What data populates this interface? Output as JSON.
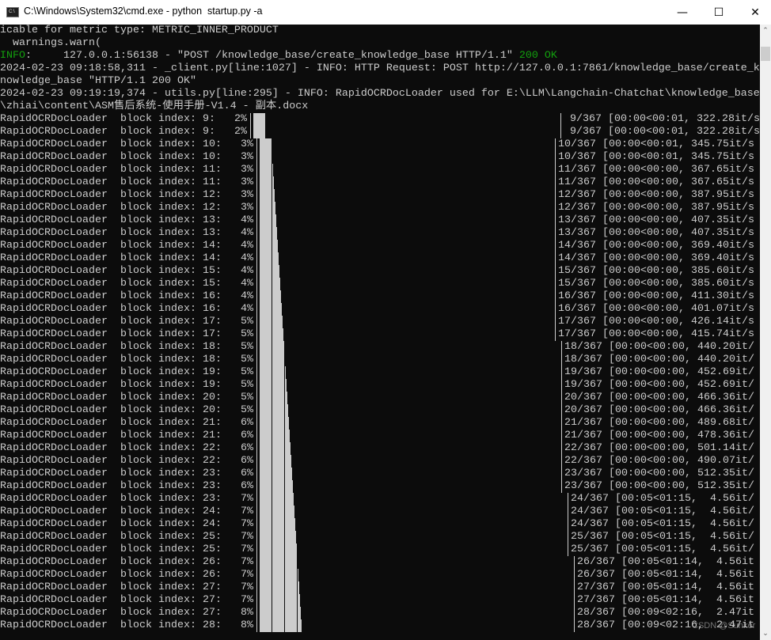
{
  "window": {
    "title": "C:\\Windows\\System32\\cmd.exe - python  startup.py -a",
    "icon": "cmd-icon",
    "icon_label": "C:\\",
    "controls": {
      "minimize": "—",
      "maximize": "☐",
      "close": "✕"
    }
  },
  "colors": {
    "background": "#0c0c0c",
    "text": "#cccccc",
    "green": "#13a10e"
  },
  "log": {
    "line0": "icable for metric type: METRIC_INNER_PRODUCT",
    "line1": "  warnings.warn(",
    "line2_level": "INFO",
    "line2_mid": ":     127.0.0.1:56138 - \"POST /knowledge_base/create_knowledge_base HTTP/1.1\" ",
    "line2_status": "200 OK",
    "line3": "2024-02-23 09:18:58,311 - _client.py[line:1027] - INFO: HTTP Request: POST http://127.0.0.1:7861/knowledge_base/create_k",
    "line4": "nowledge_base \"HTTP/1.1 200 OK\"",
    "line5": "2024-02-23 09:19:19,374 - utils.py[line:295] - INFO: RapidOCRDocLoader used for E:\\LLM\\Langchain-Chatchat\\knowledge_base",
    "line6": "\\zhiai\\content\\ASM售后系统-使用手册-V1.4 - 副本.docx"
  },
  "progress_rows": [
    {
      "desc": "RapidOCRDocLoader  block index: 9:",
      "pct": "2%",
      "count": "9/367",
      "stats": "[00:00<00:01, 322.28it/s"
    },
    {
      "desc": "RapidOCRDocLoader  block index: 9:",
      "pct": "2%",
      "count": "9/367",
      "stats": "[00:00<00:01, 322.28it/s"
    },
    {
      "desc": "RapidOCRDocLoader  block index: 10:",
      "pct": "3%",
      "count": "10/367",
      "stats": "[00:00<00:01, 345.75it/s"
    },
    {
      "desc": "RapidOCRDocLoader  block index: 10:",
      "pct": "3%",
      "count": "10/367",
      "stats": "[00:00<00:01, 345.75it/s"
    },
    {
      "desc": "RapidOCRDocLoader  block index: 11:",
      "pct": "3%",
      "count": "11/367",
      "stats": "[00:00<00:00, 367.65it/s"
    },
    {
      "desc": "RapidOCRDocLoader  block index: 11:",
      "pct": "3%",
      "count": "11/367",
      "stats": "[00:00<00:00, 367.65it/s"
    },
    {
      "desc": "RapidOCRDocLoader  block index: 12:",
      "pct": "3%",
      "count": "12/367",
      "stats": "[00:00<00:00, 387.95it/s"
    },
    {
      "desc": "RapidOCRDocLoader  block index: 12:",
      "pct": "3%",
      "count": "12/367",
      "stats": "[00:00<00:00, 387.95it/s"
    },
    {
      "desc": "RapidOCRDocLoader  block index: 13:",
      "pct": "4%",
      "count": "13/367",
      "stats": "[00:00<00:00, 407.35it/s"
    },
    {
      "desc": "RapidOCRDocLoader  block index: 13:",
      "pct": "4%",
      "count": "13/367",
      "stats": "[00:00<00:00, 407.35it/s"
    },
    {
      "desc": "RapidOCRDocLoader  block index: 14:",
      "pct": "4%",
      "count": "14/367",
      "stats": "[00:00<00:00, 369.40it/s"
    },
    {
      "desc": "RapidOCRDocLoader  block index: 14:",
      "pct": "4%",
      "count": "14/367",
      "stats": "[00:00<00:00, 369.40it/s"
    },
    {
      "desc": "RapidOCRDocLoader  block index: 15:",
      "pct": "4%",
      "count": "15/367",
      "stats": "[00:00<00:00, 385.60it/s"
    },
    {
      "desc": "RapidOCRDocLoader  block index: 15:",
      "pct": "4%",
      "count": "15/367",
      "stats": "[00:00<00:00, 385.60it/s"
    },
    {
      "desc": "RapidOCRDocLoader  block index: 16:",
      "pct": "4%",
      "count": "16/367",
      "stats": "[00:00<00:00, 411.30it/s"
    },
    {
      "desc": "RapidOCRDocLoader  block index: 16:",
      "pct": "4%",
      "count": "16/367",
      "stats": "[00:00<00:00, 401.07it/s"
    },
    {
      "desc": "RapidOCRDocLoader  block index: 17:",
      "pct": "5%",
      "count": "17/367",
      "stats": "[00:00<00:00, 426.14it/s"
    },
    {
      "desc": "RapidOCRDocLoader  block index: 17:",
      "pct": "5%",
      "count": "17/367",
      "stats": "[00:00<00:00, 415.74it/s"
    },
    {
      "desc": "RapidOCRDocLoader  block index: 18:",
      "pct": "5%",
      "count": "18/367",
      "stats": "[00:00<00:00, 440.20it/"
    },
    {
      "desc": "RapidOCRDocLoader  block index: 18:",
      "pct": "5%",
      "count": "18/367",
      "stats": "[00:00<00:00, 440.20it/"
    },
    {
      "desc": "RapidOCRDocLoader  block index: 19:",
      "pct": "5%",
      "count": "19/367",
      "stats": "[00:00<00:00, 452.69it/"
    },
    {
      "desc": "RapidOCRDocLoader  block index: 19:",
      "pct": "5%",
      "count": "19/367",
      "stats": "[00:00<00:00, 452.69it/"
    },
    {
      "desc": "RapidOCRDocLoader  block index: 20:",
      "pct": "5%",
      "count": "20/367",
      "stats": "[00:00<00:00, 466.36it/"
    },
    {
      "desc": "RapidOCRDocLoader  block index: 20:",
      "pct": "5%",
      "count": "20/367",
      "stats": "[00:00<00:00, 466.36it/"
    },
    {
      "desc": "RapidOCRDocLoader  block index: 21:",
      "pct": "6%",
      "count": "21/367",
      "stats": "[00:00<00:00, 489.68it/"
    },
    {
      "desc": "RapidOCRDocLoader  block index: 21:",
      "pct": "6%",
      "count": "21/367",
      "stats": "[00:00<00:00, 478.36it/"
    },
    {
      "desc": "RapidOCRDocLoader  block index: 22:",
      "pct": "6%",
      "count": "22/367",
      "stats": "[00:00<00:00, 501.14it/"
    },
    {
      "desc": "RapidOCRDocLoader  block index: 22:",
      "pct": "6%",
      "count": "22/367",
      "stats": "[00:00<00:00, 490.07it/"
    },
    {
      "desc": "RapidOCRDocLoader  block index: 23:",
      "pct": "6%",
      "count": "23/367",
      "stats": "[00:00<00:00, 512.35it/"
    },
    {
      "desc": "RapidOCRDocLoader  block index: 23:",
      "pct": "6%",
      "count": "23/367",
      "stats": "[00:00<00:00, 512.35it/"
    },
    {
      "desc": "RapidOCRDocLoader  block index: 23:",
      "pct": "7%",
      "count": "24/367",
      "stats": "[00:05<01:15,  4.56it/"
    },
    {
      "desc": "RapidOCRDocLoader  block index: 24:",
      "pct": "7%",
      "count": "24/367",
      "stats": "[00:05<01:15,  4.56it/"
    },
    {
      "desc": "RapidOCRDocLoader  block index: 24:",
      "pct": "7%",
      "count": "24/367",
      "stats": "[00:05<01:15,  4.56it/"
    },
    {
      "desc": "RapidOCRDocLoader  block index: 25:",
      "pct": "7%",
      "count": "25/367",
      "stats": "[00:05<01:15,  4.56it/"
    },
    {
      "desc": "RapidOCRDocLoader  block index: 25:",
      "pct": "7%",
      "count": "25/367",
      "stats": "[00:05<01:15,  4.56it/"
    },
    {
      "desc": "RapidOCRDocLoader  block index: 26:",
      "pct": "7%",
      "count": "26/367",
      "stats": "[00:05<01:14,  4.56it"
    },
    {
      "desc": "RapidOCRDocLoader  block index: 26:",
      "pct": "7%",
      "count": "26/367",
      "stats": "[00:05<01:14,  4.56it"
    },
    {
      "desc": "RapidOCRDocLoader  block index: 27:",
      "pct": "7%",
      "count": "27/367",
      "stats": "[00:05<01:14,  4.56it"
    },
    {
      "desc": "RapidOCRDocLoader  block index: 27:",
      "pct": "7%",
      "count": "27/367",
      "stats": "[00:05<01:14,  4.56it"
    },
    {
      "desc": "RapidOCRDocLoader  block index: 27:",
      "pct": "8%",
      "count": "28/367",
      "stats": "[00:09<02:16,  2.47it"
    },
    {
      "desc": "RapidOCRDocLoader  block index: 28:",
      "pct": "8%",
      "count": "28/367",
      "stats": "[00:09<02:16,  2.47it"
    }
  ],
  "scrollbar": {
    "up_icon": "chevron-up-icon",
    "down_icon": "chevron-down-icon",
    "up": "⌃",
    "down": "⌄"
  },
  "watermark": "CSDN @Sunkor"
}
